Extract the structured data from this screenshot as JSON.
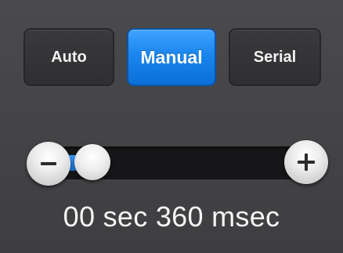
{
  "mode_buttons": {
    "auto_label": "Auto",
    "manual_label": "Manual",
    "serial_label": "Serial",
    "selected": "Manual"
  },
  "slider": {
    "minus_icon": "minus-icon",
    "plus_icon": "plus-icon",
    "value_fraction": 0.15,
    "accent_color": "#1a86ee"
  },
  "readout": {
    "text": "00 sec 360 msec"
  }
}
